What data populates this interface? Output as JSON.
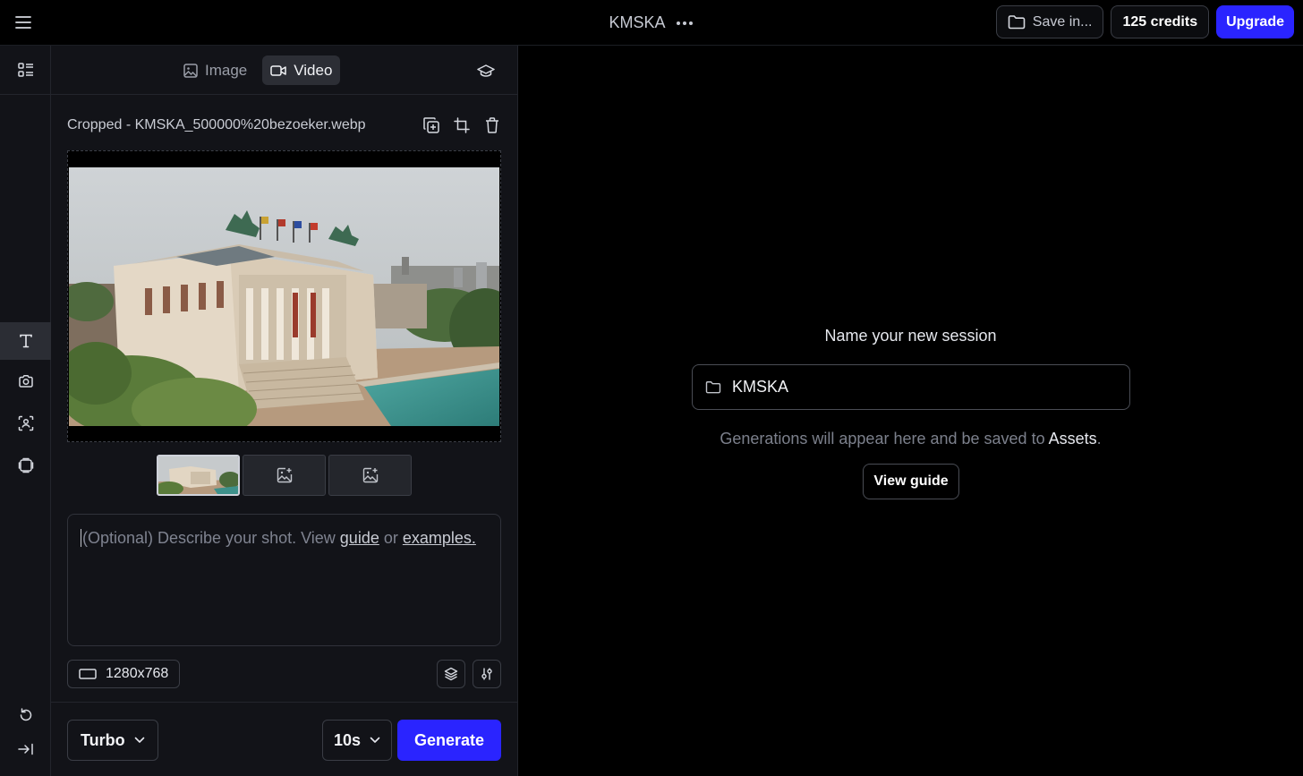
{
  "topbar": {
    "title": "KMSKA",
    "save_label": "Save in...",
    "credits_label": "125 credits",
    "upgrade_label": "Upgrade"
  },
  "panel": {
    "tabs": [
      {
        "label": "Image",
        "active": false
      },
      {
        "label": "Video",
        "active": true
      }
    ],
    "file_name": "Cropped - KMSKA_500000%20bezoeker.webp",
    "prompt": {
      "placeholder_prefix": "(Optional) Describe your shot. View ",
      "guide_link": "guide",
      "or_text": " or ",
      "examples_link": "examples."
    },
    "resolution": "1280x768",
    "model_label": "Turbo",
    "duration_label": "10s",
    "generate_label": "Generate"
  },
  "main": {
    "session_label": "Name your new session",
    "session_value": "KMSKA",
    "hint_prefix": "Generations will appear here and be saved to ",
    "hint_link": "Assets",
    "hint_suffix": ".",
    "guide_button": "View guide"
  },
  "colors": {
    "accent": "#2a24ff",
    "background": "#000000",
    "panel": "#121318"
  }
}
